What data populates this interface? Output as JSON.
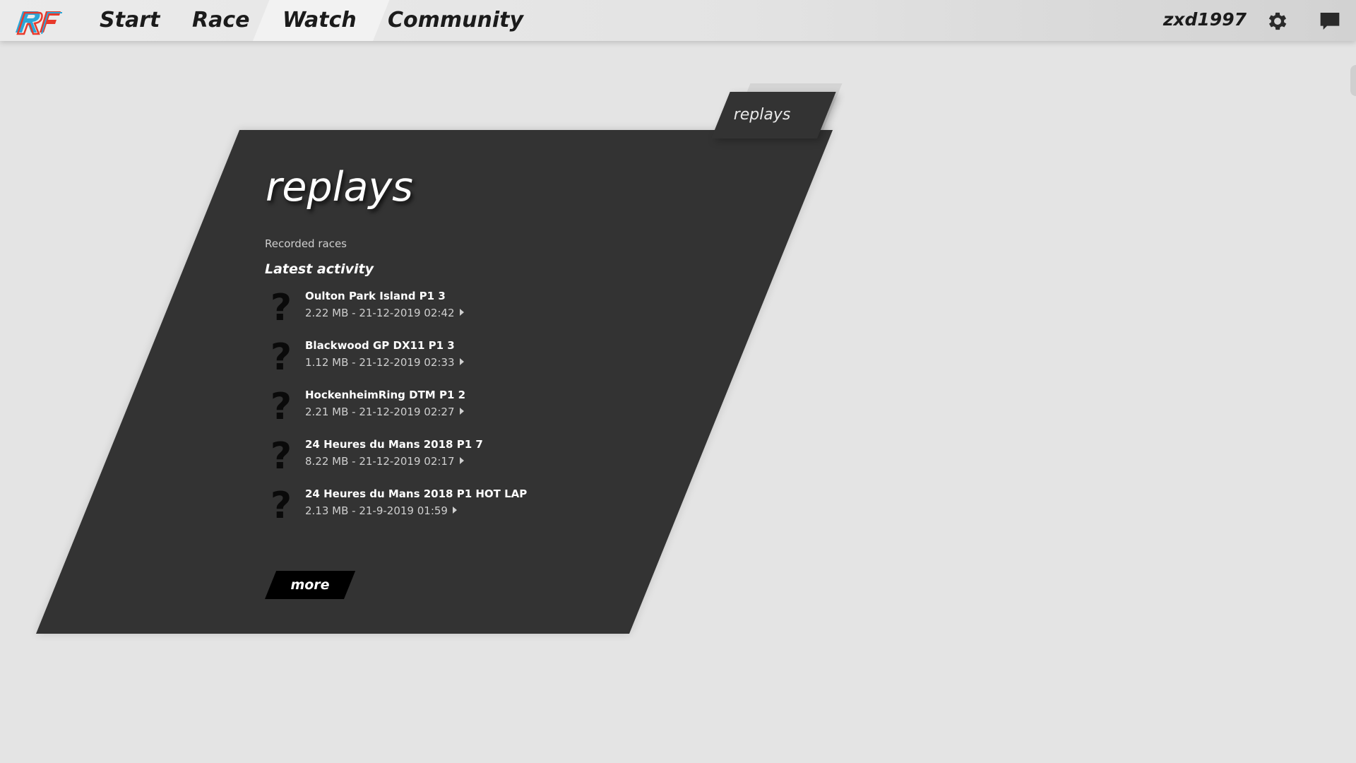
{
  "nav": {
    "items": [
      {
        "label": "Start"
      },
      {
        "label": "Race"
      },
      {
        "label": "Watch"
      },
      {
        "label": "Community"
      }
    ],
    "active": "Watch",
    "username": "zxd1997"
  },
  "tab": {
    "label": "replays"
  },
  "panel": {
    "title": "replays",
    "subtitle": "Recorded races",
    "section_title": "Latest activity",
    "items": [
      {
        "name": "Oulton Park Island P1 3",
        "meta": "2.22 MB - 21-12-2019 02:42"
      },
      {
        "name": "Blackwood GP DX11 P1 3",
        "meta": "1.12 MB - 21-12-2019 02:33"
      },
      {
        "name": "HockenheimRing DTM P1 2",
        "meta": "2.21 MB - 21-12-2019 02:27"
      },
      {
        "name": "24 Heures du Mans 2018 P1 7",
        "meta": "8.22 MB - 21-12-2019 02:17"
      },
      {
        "name": "24 Heures du Mans 2018 P1 HOT LAP",
        "meta": "2.13 MB - 21-9-2019 01:59"
      }
    ],
    "item_icon": "?",
    "more_label": "more"
  },
  "colors": {
    "background": "#e4e4e4",
    "panel": "#333333",
    "accent_red": "#e8392b",
    "accent_blue": "#2aa6d8"
  }
}
